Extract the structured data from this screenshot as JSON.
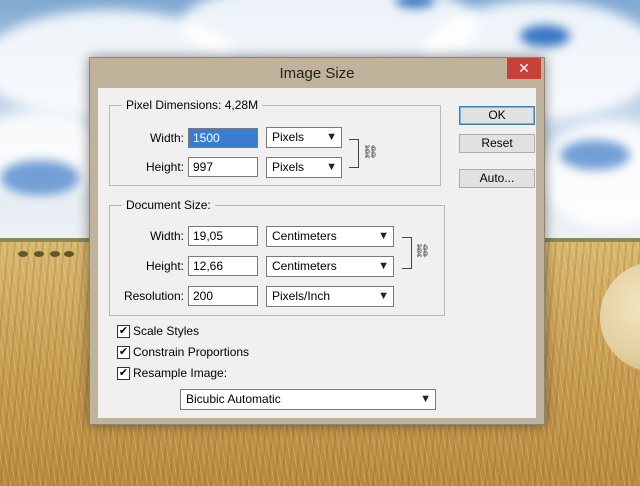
{
  "dialog": {
    "title": "Image Size",
    "close_label": "✕",
    "pixel_dimensions": {
      "legend": "Pixel Dimensions:",
      "size": "4,28M",
      "width_label_pre": "Width:",
      "width_value": "1500",
      "width_unit": "Pixels",
      "height_label": "Height:",
      "height_value": "997",
      "height_unit": "Pixels"
    },
    "document_size": {
      "legend": "Document Size:",
      "width_label": "Width:",
      "width_value": "19,05",
      "width_unit": "Centimeters",
      "height_label": "Height:",
      "height_value": "12,66",
      "height_unit": "Centimeters",
      "resolution_label": "Resolution:",
      "resolution_value": "200",
      "resolution_unit": "Pixels/Inch"
    },
    "options": {
      "scale_styles": "Scale Styles",
      "constrain_proportions": "Constrain Proportions",
      "resample_image": "Resample Image:",
      "resample_method": "Bicubic Automatic"
    },
    "buttons": {
      "ok": "OK",
      "reset": "Reset",
      "auto": "Auto..."
    }
  }
}
